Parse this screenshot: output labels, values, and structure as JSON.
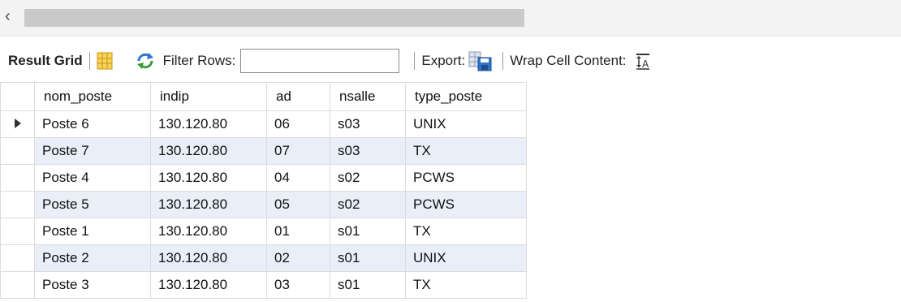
{
  "scroll": {
    "arrow": "‹"
  },
  "toolbar": {
    "result_grid_label": "Result Grid",
    "filter_label": "Filter Rows:",
    "filter_value": "",
    "export_label": "Export:",
    "wrap_label": "Wrap Cell Content:",
    "icons": [
      "grid-layout-icon",
      "refresh-icon",
      "export-icon",
      "wrap-text-icon"
    ]
  },
  "table": {
    "columns": [
      "nom_poste",
      "indip",
      "ad",
      "nsalle",
      "type_poste"
    ],
    "rows": [
      [
        "Poste 6",
        "130.120.80",
        "06",
        "s03",
        "UNIX"
      ],
      [
        "Poste 7",
        "130.120.80",
        "07",
        "s03",
        "TX"
      ],
      [
        "Poste 4",
        "130.120.80",
        "04",
        "s02",
        "PCWS"
      ],
      [
        "Poste 5",
        "130.120.80",
        "05",
        "s02",
        "PCWS"
      ],
      [
        "Poste 1",
        "130.120.80",
        "01",
        "s01",
        "TX"
      ],
      [
        "Poste 2",
        "130.120.80",
        "02",
        "s01",
        "UNIX"
      ],
      [
        "Poste 3",
        "130.120.80",
        "03",
        "s01",
        "TX"
      ]
    ],
    "selected_row": 0
  },
  "colors": {
    "alt_row": "#e9eef8",
    "grid_line": "#dcdcdc",
    "accent_blue": "#2f74c9",
    "icon_yellow": "#f2b81a"
  }
}
